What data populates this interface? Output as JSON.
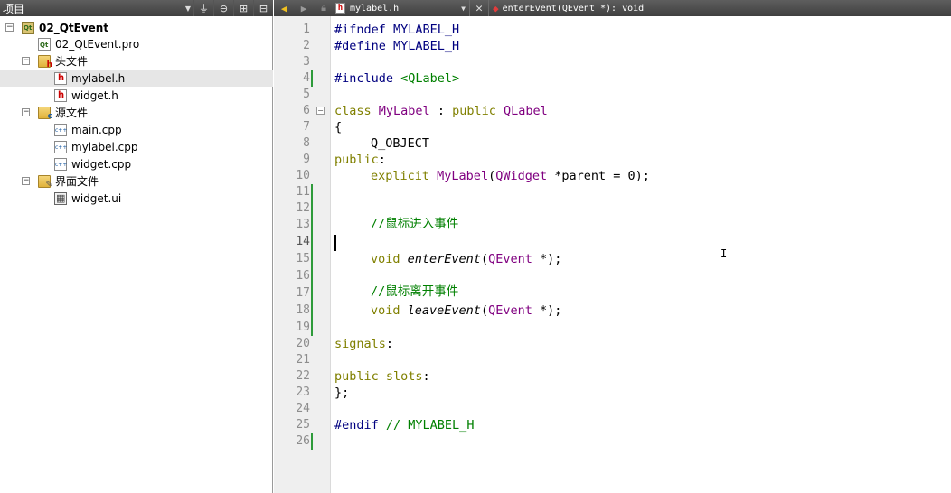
{
  "project_panel": {
    "title": "项目",
    "toolbar_icons": [
      "filter-icon",
      "sync-icon",
      "split-icon",
      "close-panel-icon"
    ]
  },
  "tree": {
    "project": "02_QtEvent",
    "pro_file": "02_QtEvent.pro",
    "headers_folder": "头文件",
    "headers": [
      "mylabel.h",
      "widget.h"
    ],
    "sources_folder": "源文件",
    "sources": [
      "main.cpp",
      "mylabel.cpp",
      "widget.cpp"
    ],
    "forms_folder": "界面文件",
    "forms": [
      "widget.ui"
    ]
  },
  "editor_toolbar": {
    "file": "mylabel.h",
    "symbol": "enterEvent(QEvent *): void"
  },
  "editor": {
    "line_numbers": [
      "1",
      "2",
      "3",
      "4",
      "5",
      "6",
      "7",
      "8",
      "9",
      "10",
      "11",
      "12",
      "13",
      "14",
      "15",
      "16",
      "17",
      "18",
      "19",
      "20",
      "21",
      "22",
      "23",
      "24",
      "25",
      "26"
    ],
    "current_line": 14
  },
  "code": {
    "l1": "#ifndef MYLABEL_H",
    "l2": "#define MYLABEL_H",
    "l4_kw": "#include ",
    "l4_inc": "<QLabel>",
    "l6_kw": "class",
    "l6_name": "MyLabel",
    "l6_colon": " : ",
    "l6_public": "public",
    "l6_base": "QLabel",
    "l7": "{",
    "l8": "Q_OBJECT",
    "l9_kw": "public",
    "l9_colon": ":",
    "l10_kw": "explicit",
    "l10_name": "MyLabel",
    "l10_p1": "(",
    "l10_type": "QWidget",
    "l10_rest": " *parent = 0);",
    "l13": "//鼠标进入事件",
    "l15_kw": "void",
    "l15_fn": "enterEvent",
    "l15_p1": "(",
    "l15_type": "QEvent",
    "l15_rest": " *);",
    "l17": "//鼠标离开事件",
    "l18_kw": "void",
    "l18_fn": "leaveEvent",
    "l18_p1": "(",
    "l18_type": "QEvent",
    "l18_rest": " *);",
    "l20_kw": "signals",
    "l20_colon": ":",
    "l22_kw": "public slots",
    "l22_colon": ":",
    "l23": "};",
    "l25_kw": "#endif",
    "l25_cm": " // MYLABEL_H"
  }
}
